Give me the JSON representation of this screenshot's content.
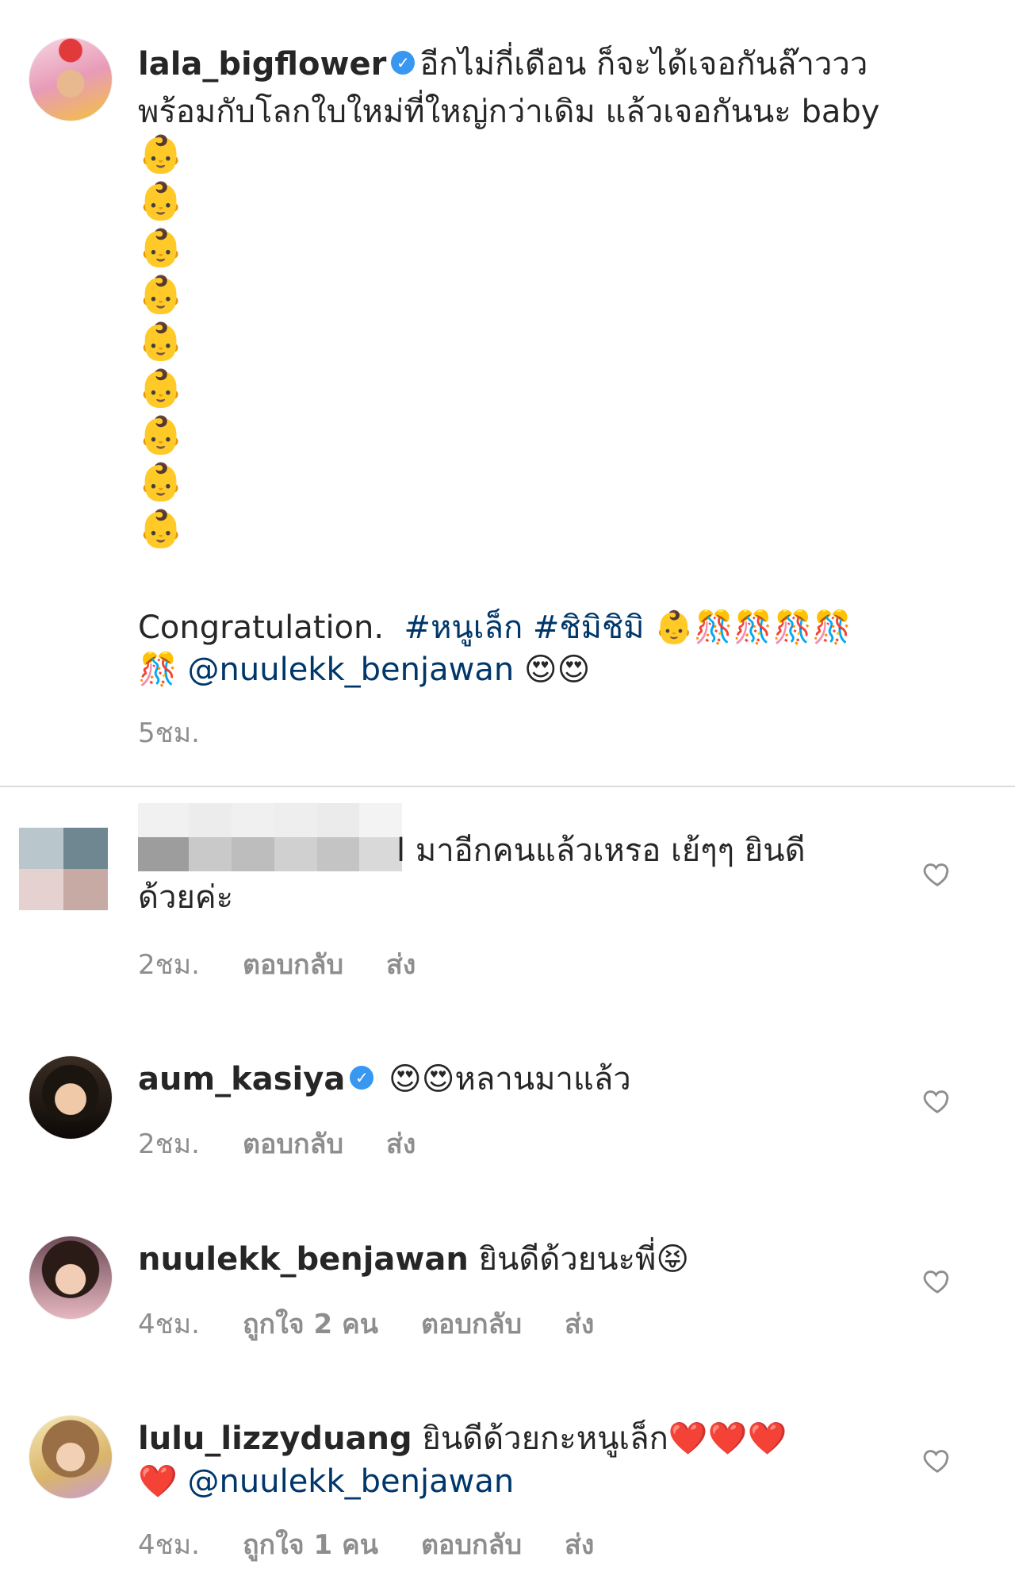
{
  "post": {
    "username": "lala_bigflower",
    "verified_icon": "verified-badge-icon",
    "line1": "อีกไม่กี่เดือน ก็จะได้เจอกันล๊าววว",
    "line2": "พร้อมกับโลกใบใหม่ที่ใหญ่กว่าเดิม แล้วเจอกันนะ baby",
    "baby_emoji": "👶",
    "congrats_text": "Congratulation.",
    "hashtag1": "#หนูเล็ก",
    "hashtag2": "#ชิมิชิมิ",
    "confetti_emoji": "🎊",
    "mention": "@nuulekk_benjawan",
    "love_eyes_emoji": "😍",
    "time": "5ชม."
  },
  "comments": [
    {
      "username": "",
      "text_line1": "l มาอีกคนแล้วเหรอ เย้ๆๆ ยินดี",
      "text_line2": "ด้วยค่ะ",
      "time": "2ชม.",
      "reply_label": "ตอบกลับ",
      "send_label": "ส่ง"
    },
    {
      "username": "aum_kasiya",
      "text": "หลานมาแล้ว",
      "emoji": "😍",
      "time": "2ชม.",
      "reply_label": "ตอบกลับ",
      "send_label": "ส่ง"
    },
    {
      "username": "nuulekk_benjawan",
      "text": "ยินดีด้วยนะพี่",
      "emoji": "😝",
      "time": "4ชม.",
      "likes": "ถูกใจ 2 คน",
      "reply_label": "ตอบกลับ",
      "send_label": "ส่ง"
    },
    {
      "username": "lulu_lizzyduang",
      "text": "ยินดีด้วยกะหนูเล็ก",
      "heart_emoji": "❤️",
      "mention": "@nuulekk_benjawan",
      "time": "4ชม.",
      "likes": "ถูกใจ 1 คน",
      "reply_label": "ตอบกลับ",
      "send_label": "ส่ง"
    }
  ],
  "colors": {
    "link": "#00376b",
    "meta": "#8e8e8e",
    "verified": "#3897f0"
  }
}
